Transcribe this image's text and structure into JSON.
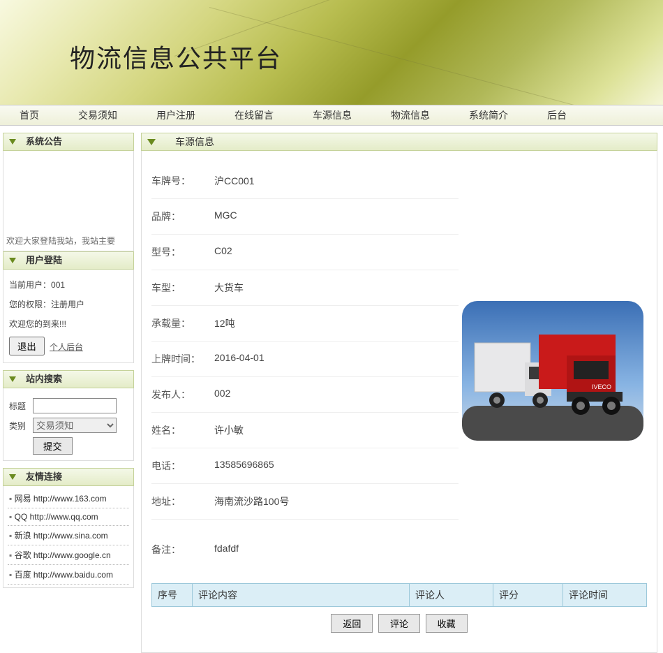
{
  "site_title": "物流信息公共平台",
  "nav": [
    "首页",
    "交易须知",
    "用户注册",
    "在线留言",
    "车源信息",
    "物流信息",
    "系统简介",
    "后台"
  ],
  "announce": {
    "title": "系统公告",
    "welcome": "欢迎大家登陆我站，我站主要"
  },
  "login": {
    "title": "用户登陆",
    "current_user_label": "当前用户：",
    "current_user": "001",
    "role_label": "您的权限：",
    "role": "注册用户",
    "greeting": "欢迎您的到来!!!",
    "logout": "退出",
    "backend": "个人后台"
  },
  "search": {
    "title": "站内搜索",
    "title_label": "标题",
    "title_value": "",
    "cat_label": "类别",
    "cat_value": "交易须知",
    "submit": "提交"
  },
  "links": {
    "title": "友情连接",
    "items": [
      "网易 http://www.163.com",
      "QQ http://www.qq.com",
      "新浪 http://www.sina.com",
      "谷歌 http://www.google.cn",
      "百度 http://www.baidu.com"
    ]
  },
  "panel": {
    "title": "车源信息",
    "rows": [
      {
        "label": "车牌号：",
        "value": "沪CC001"
      },
      {
        "label": "品牌：",
        "value": "MGC"
      },
      {
        "label": "型号：",
        "value": "C02"
      },
      {
        "label": "车型：",
        "value": "大货车"
      },
      {
        "label": "承载量：",
        "value": "12吨"
      },
      {
        "label": "上牌时间：",
        "value": "2016-04-01"
      },
      {
        "label": "发布人：",
        "value": "002"
      },
      {
        "label": "姓名：",
        "value": "许小敏"
      },
      {
        "label": "电话：",
        "value": "13585696865"
      },
      {
        "label": "地址：",
        "value": "海南流沙路100号"
      }
    ],
    "remark_label": "备注：",
    "remark_value": "fdafdf",
    "columns": [
      "序号",
      "评论内容",
      "评论人",
      "评分",
      "评论时间"
    ],
    "buttons": {
      "back": "返回",
      "comment": "评论",
      "fav": "收藏"
    }
  }
}
